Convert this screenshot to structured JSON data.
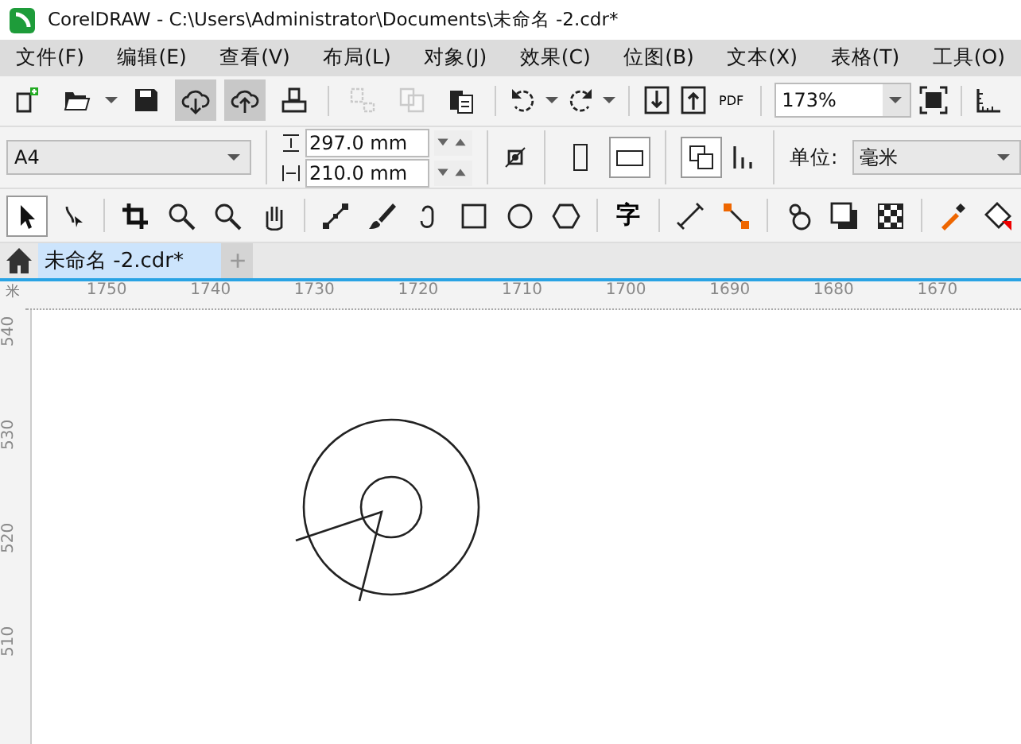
{
  "window": {
    "title": "CorelDRAW - C:\\Users\\Administrator\\Documents\\未命名 -2.cdr*"
  },
  "menu": [
    "文件(F)",
    "编辑(E)",
    "查看(V)",
    "布局(L)",
    "对象(J)",
    "效果(C)",
    "位图(B)",
    "文本(X)",
    "表格(T)",
    "工具(O)"
  ],
  "toolbar": {
    "buttons": [
      {
        "pressed": false,
        "disabled": false
      },
      {
        "pressed": false,
        "disabled": false
      },
      {
        "pressed": false,
        "disabled": false
      },
      {
        "pressed": true,
        "disabled": false
      },
      {
        "pressed": true,
        "disabled": false
      },
      {
        "pressed": false,
        "disabled": false
      },
      {
        "pressed": false,
        "disabled": true
      },
      {
        "pressed": false,
        "disabled": true
      },
      {
        "pressed": false,
        "disabled": false
      }
    ],
    "pdf_label": "PDF",
    "zoom": "173%"
  },
  "property_bar": {
    "page_size": "A4",
    "width": "297.0 mm",
    "height": "210.0 mm",
    "orientation_landscape": true,
    "unit_label": "单位:",
    "unit": "毫米"
  },
  "toolbox": {
    "text_tool": "字",
    "tools": [
      {
        "selected": true
      },
      {
        "selected": false
      },
      {
        "selected": false
      },
      {
        "selected": false
      },
      {
        "selected": false
      },
      {
        "selected": false
      },
      {
        "selected": false
      },
      {
        "selected": false
      },
      {
        "selected": false
      },
      {
        "selected": false
      },
      {
        "selected": false
      },
      {
        "selected": false
      },
      {
        "selected": false
      },
      {
        "selected": false
      },
      {
        "selected": false
      },
      {
        "selected": false
      },
      {
        "selected": false
      },
      {
        "selected": false
      },
      {
        "selected": false
      },
      {
        "selected": false
      }
    ]
  },
  "tabs": [
    {
      "label": "未命名 -2.cdr*",
      "selected": true
    }
  ],
  "new_tab": "+",
  "ruler": {
    "unit": "米",
    "h_labels": [
      "1750",
      "1740",
      "1730",
      "1720",
      "1710",
      "1700",
      "1690",
      "1680",
      "1670"
    ],
    "v_labels": [
      "540",
      "530",
      "520",
      "510"
    ]
  }
}
